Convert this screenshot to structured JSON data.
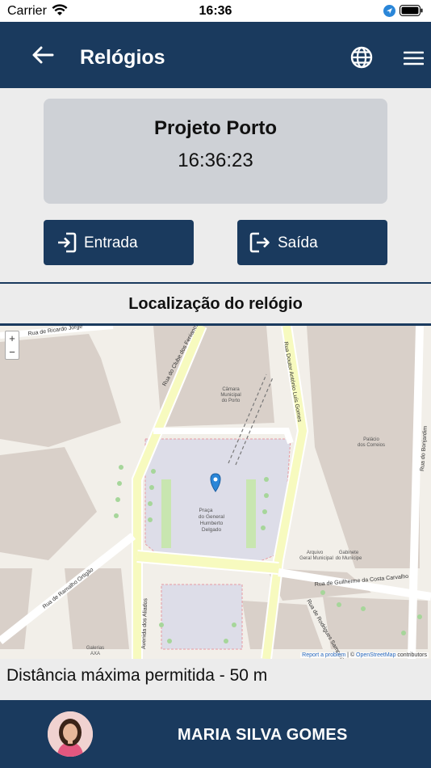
{
  "status": {
    "carrier": "Carrier",
    "time": "16:36"
  },
  "header": {
    "title": "Relógios"
  },
  "clock_card": {
    "project": "Projeto Porto",
    "time": "16:36:23"
  },
  "actions": {
    "entry_label": "Entrada",
    "exit_label": "Saída"
  },
  "section": {
    "title": "Localização do relógio"
  },
  "map": {
    "streets": [
      "Rua do Clube dos Fenianos",
      "Rua Doutor António Luís Gomes",
      "Rua de Guilherme da Costa Carvalho",
      "Rua do Bonjardim",
      "Rua de Ramalho Ortigão",
      "Avenida dos Aliados",
      "Rua de Ricardo Jorge",
      "Rua de Rodrigues Sampaio"
    ],
    "places": [
      "Praça do General Humberto Delgado",
      "Câmara Municipal do Porto",
      "Palácio dos Correios",
      "Galerias AXA",
      "Arquivo Geral Municipal",
      "Gabinete do Munícipe"
    ],
    "attribution": {
      "report": "Report a problem",
      "separator": " | © ",
      "osm": "OpenStreetMap",
      "contributors": " contributors"
    },
    "zoom_in": "+",
    "zoom_out": "−"
  },
  "distance": {
    "text": "Distância máxima permitida - 50 m"
  },
  "user": {
    "name": "MARIA SILVA GOMES"
  },
  "colors": {
    "primary": "#1a3a5e",
    "card": "#ced1d6",
    "background": "#ececec",
    "pin": "#2a86d8"
  },
  "icons": [
    "back-arrow-icon",
    "globe-icon",
    "menu-icon",
    "entry-icon",
    "exit-icon",
    "map-pin-icon",
    "avatar"
  ]
}
